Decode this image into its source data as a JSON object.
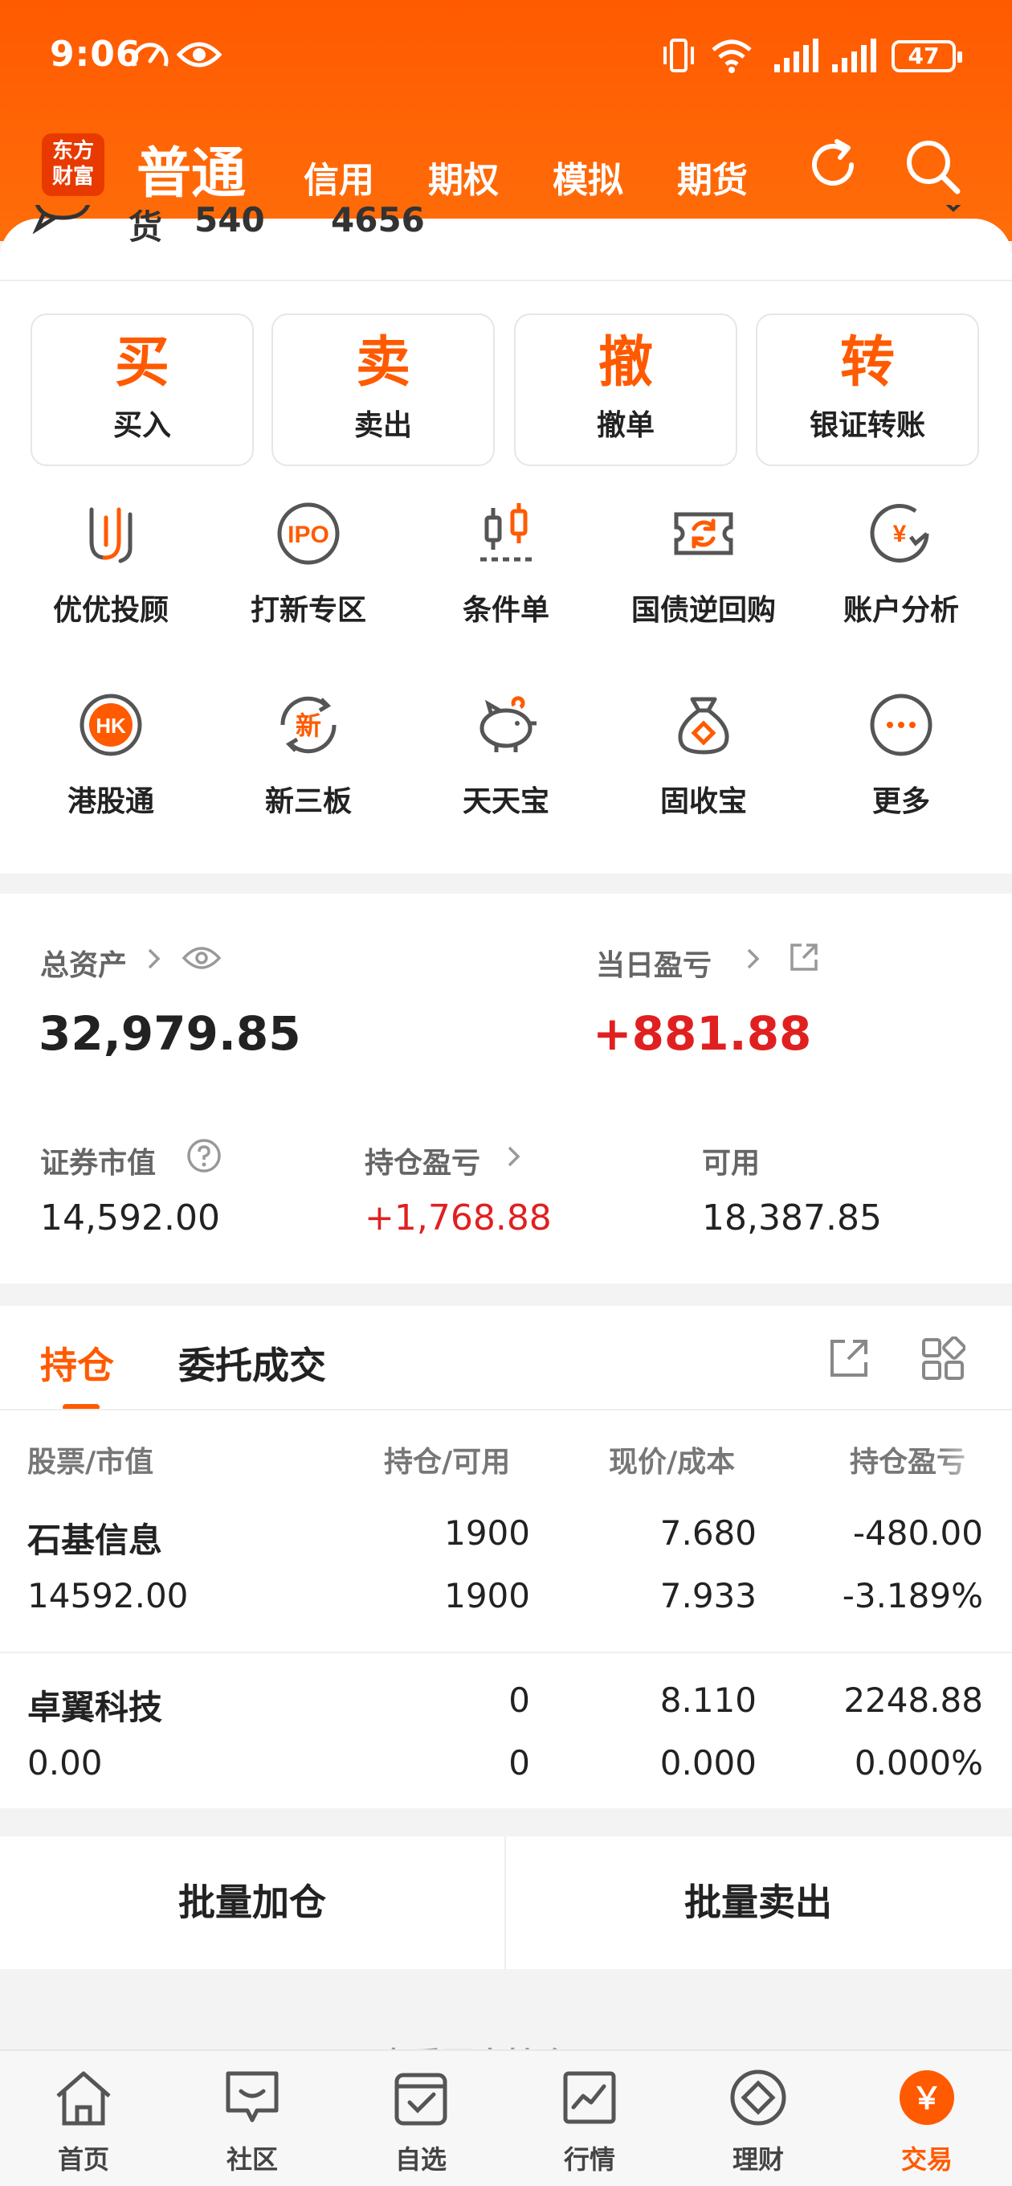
{
  "status_bar": {
    "time": "9:06",
    "battery": "47"
  },
  "header": {
    "logo_text": "东方财富",
    "logo_line1": "东方",
    "logo_line2": "财富",
    "active_tab": "普通",
    "tabs": [
      "信用",
      "期权",
      "模拟",
      "期货"
    ]
  },
  "peek_row": {
    "label": "货",
    "value1": "540",
    "value2": "4656"
  },
  "quick_actions": [
    {
      "big": "买",
      "label": "买入"
    },
    {
      "big": "卖",
      "label": "卖出"
    },
    {
      "big": "撤",
      "label": "撤单"
    },
    {
      "big": "转",
      "label": "银证转账"
    }
  ],
  "features_row1": [
    {
      "icon": "advisor-icon",
      "label": "优优投顾"
    },
    {
      "icon": "ipo-icon",
      "icon_text": "IPO",
      "label": "打新专区"
    },
    {
      "icon": "conditional-order-icon",
      "label": "条件单"
    },
    {
      "icon": "treasury-repo-icon",
      "label": "国债逆回购"
    },
    {
      "icon": "account-analysis-icon",
      "icon_text": "¥",
      "label": "账户分析"
    }
  ],
  "features_row2": [
    {
      "icon": "hk-connect-icon",
      "icon_text": "HK",
      "label": "港股通"
    },
    {
      "icon": "new-third-board-icon",
      "icon_text": "新",
      "label": "新三板"
    },
    {
      "icon": "piggy-bank-icon",
      "label": "天天宝"
    },
    {
      "icon": "money-bag-icon",
      "label": "固收宝"
    },
    {
      "icon": "more-icon",
      "label": "更多"
    }
  ],
  "assets": {
    "total_label": "总资产",
    "total_value": "32,979.85",
    "daily_pl_label": "当日盈亏",
    "daily_pl_value": "+881.88",
    "market_value_label": "证券市值",
    "market_value": "14,592.00",
    "position_pl_label": "持仓盈亏",
    "position_pl_value": "+1,768.88",
    "available_label": "可用",
    "available_value": "18,387.85"
  },
  "holdings": {
    "tabs": [
      "持仓",
      "委托成交"
    ],
    "columns": [
      "股票/市值",
      "持仓/可用",
      "现价/成本",
      "持仓盈亏"
    ],
    "rows": [
      {
        "name": "石基信息",
        "market_value": "14592.00",
        "position": "1900",
        "available": "1900",
        "price": "7.680",
        "cost": "7.933",
        "pl": "-480.00",
        "pl_pct": "-3.189%"
      },
      {
        "name": "卓翼科技",
        "market_value": "0.00",
        "position": "0",
        "available": "0",
        "price": "8.110",
        "cost": "0.000",
        "pl": "2248.88",
        "pl_pct": "0.000%"
      }
    ]
  },
  "batch": {
    "add": "批量加仓",
    "sell": "批量卖出"
  },
  "ghost_text": "查看历史持仓",
  "bottom_nav": [
    {
      "icon": "home-icon",
      "label": "首页"
    },
    {
      "icon": "community-icon",
      "label": "社区"
    },
    {
      "icon": "watchlist-icon",
      "label": "自选"
    },
    {
      "icon": "market-icon",
      "label": "行情"
    },
    {
      "icon": "wealth-icon",
      "label": "理财"
    },
    {
      "icon": "trade-icon",
      "icon_text": "￥",
      "label": "交易"
    }
  ],
  "colors": {
    "accent": "#ff5a00",
    "up": "#e02020",
    "down": "#1a9a1a"
  }
}
